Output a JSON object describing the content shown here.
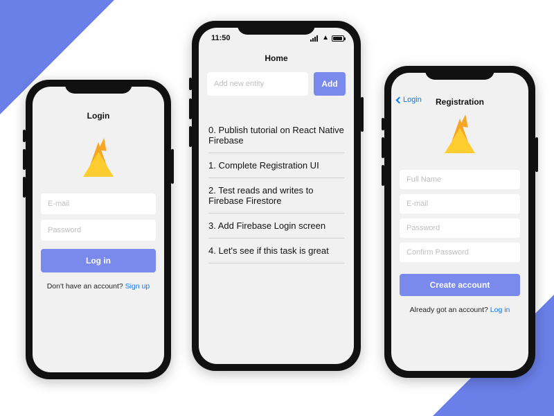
{
  "accent": "#7a89ec",
  "login": {
    "title": "Login",
    "email_ph": "E-mail",
    "password_ph": "Password",
    "button": "Log in",
    "footer_prefix": "Don't have an account? ",
    "footer_link": "Sign up"
  },
  "home": {
    "time": "11:50",
    "title": "Home",
    "add_ph": "Add new entity",
    "add_button": "Add",
    "items": [
      "0. Publish tutorial on React Native Firebase",
      "1. Complete Registration UI",
      "2. Test reads and writes to Firebase Firestore",
      "3. Add Firebase Login screen",
      "4. Let's see if this task is great"
    ]
  },
  "register": {
    "back_label": "Login",
    "title": "Registration",
    "fullname_ph": "Full Name",
    "email_ph": "E-mail",
    "password_ph": "Password",
    "confirm_ph": "Confirm Password",
    "button": "Create account",
    "footer_prefix": "Already got an account? ",
    "footer_link": "Log in"
  }
}
